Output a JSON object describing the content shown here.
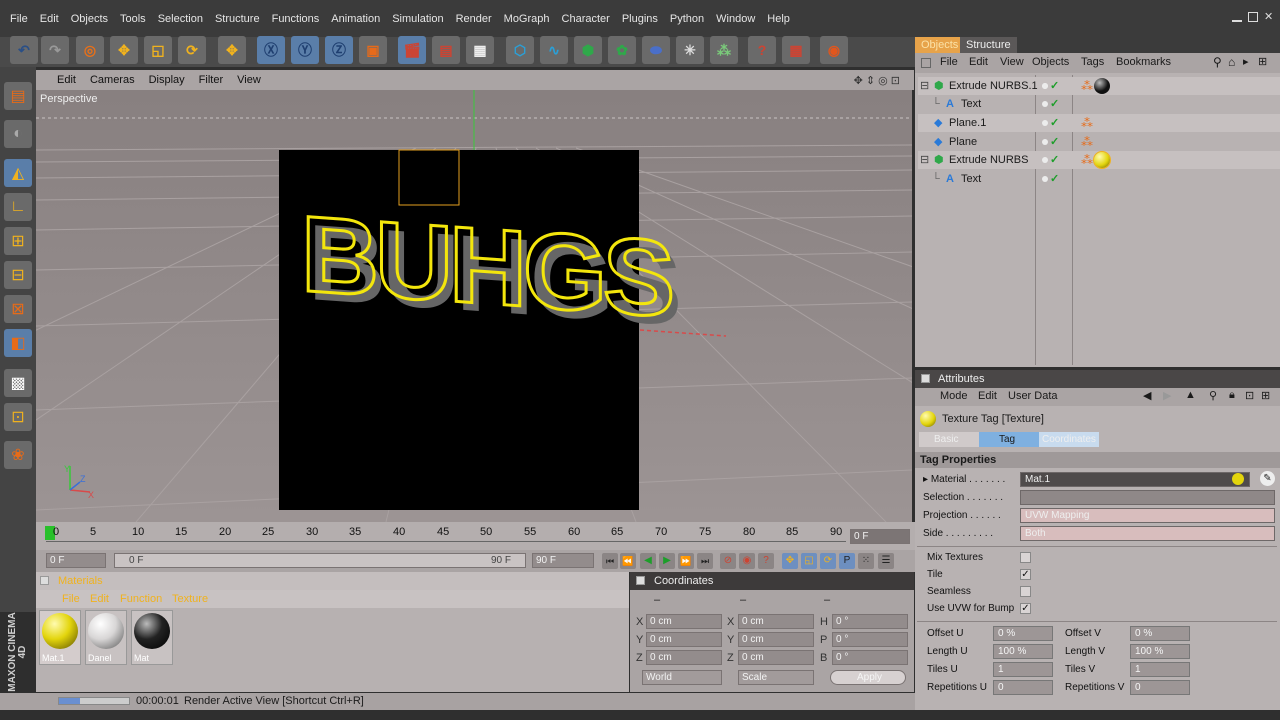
{
  "menu": [
    "File",
    "Edit",
    "Objects",
    "Tools",
    "Selection",
    "Structure",
    "Functions",
    "Animation",
    "Simulation",
    "Render",
    "MoGraph",
    "Character",
    "Plugins",
    "Python",
    "Window",
    "Help"
  ],
  "viewport": {
    "menu": [
      "Edit",
      "Cameras",
      "Display",
      "Filter",
      "View"
    ],
    "label": "Perspective",
    "text3d": "BUHGS"
  },
  "timeline": {
    "ticks": [
      "0",
      "5",
      "10",
      "15",
      "20",
      "25",
      "30",
      "35",
      "40",
      "45",
      "50",
      "55",
      "60",
      "65",
      "70",
      "75",
      "80",
      "85",
      "90"
    ],
    "end_frame": "0 F",
    "current": "0 F",
    "range_start": "0 F",
    "range_end": "90 F",
    "max": "90 F"
  },
  "materials": {
    "title": "Materials",
    "menu": [
      "File",
      "Edit",
      "Function",
      "Texture"
    ],
    "items": [
      "Mat.1",
      "Danel",
      "Mat"
    ],
    "colors": [
      "#e3d50c",
      "#d8d6d6",
      "#222222"
    ]
  },
  "coordinates": {
    "title": "Coordinates",
    "headers": [
      "–",
      "–",
      "–"
    ],
    "rows": [
      {
        "a": "X",
        "av": "0 cm",
        "b": "X",
        "bv": "0 cm",
        "c": "H",
        "cv": "0 °"
      },
      {
        "a": "Y",
        "av": "0 cm",
        "b": "Y",
        "bv": "0 cm",
        "c": "P",
        "cv": "0 °"
      },
      {
        "a": "Z",
        "av": "0 cm",
        "b": "Z",
        "bv": "0 cm",
        "c": "B",
        "cv": "0 °"
      }
    ],
    "mode": "World",
    "scale": "Scale",
    "apply": "Apply"
  },
  "status": {
    "time": "00:00:01",
    "text": "Render Active View [Shortcut Ctrl+R]",
    "brand": "MAXON CINEMA 4D"
  },
  "objects": {
    "tabs": [
      "Objects",
      "Structure"
    ],
    "menu": [
      "File",
      "Edit",
      "View",
      "Objects",
      "Tags",
      "Bookmarks"
    ],
    "rows": [
      {
        "name": "Extrude NURBS.1",
        "indent": 0,
        "icon": "extrude-icon"
      },
      {
        "name": "Text",
        "indent": 1,
        "icon": "text-icon"
      },
      {
        "name": "Plane.1",
        "indent": 0,
        "icon": "plane-icon"
      },
      {
        "name": "Plane",
        "indent": 0,
        "icon": "plane-icon"
      },
      {
        "name": "Extrude NURBS",
        "indent": 0,
        "icon": "extrude-icon"
      },
      {
        "name": "Text",
        "indent": 1,
        "icon": "text-icon"
      }
    ]
  },
  "attributes": {
    "title": "Attributes",
    "menu": [
      "Mode",
      "Edit",
      "User Data"
    ],
    "object": "Texture Tag [Texture]",
    "tabs": [
      "Basic",
      "Tag",
      "Coordinates"
    ],
    "section": "Tag Properties",
    "material_label": "Material",
    "material_value": "Mat.1",
    "selection_label": "Selection",
    "projection_label": "Projection",
    "projection_value": "UVW Mapping",
    "side_label": "Side",
    "side_value": "Both",
    "checks": [
      {
        "label": "Mix Textures",
        "checked": ""
      },
      {
        "label": "Tile",
        "checked": "✓"
      },
      {
        "label": "Seamless",
        "checked": ""
      },
      {
        "label": "Use UVW for Bump",
        "checked": "✓"
      }
    ],
    "offset_u": "0 %",
    "offset_v": "0 %",
    "length_u": "100 %",
    "length_v": "100 %",
    "tiles_u": "1",
    "tiles_v": "1",
    "rep_u": "0",
    "rep_v": "0",
    "labels": {
      "offset_u": "Offset U",
      "offset_v": "Offset V",
      "length_u": "Length U",
      "length_v": "Length V",
      "tiles_u": "Tiles U",
      "tiles_v": "Tiles V",
      "rep_u": "Repetitions U",
      "rep_v": "Repetitions V"
    }
  }
}
